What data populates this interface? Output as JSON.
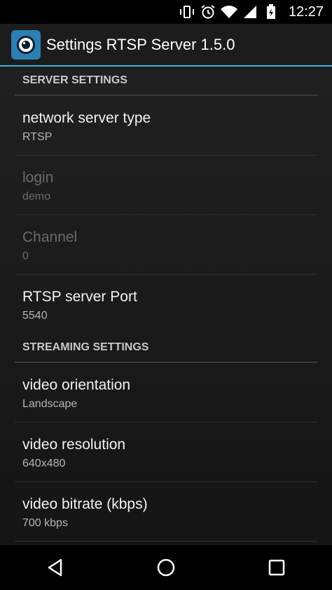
{
  "statusbar": {
    "time": "12:27",
    "icons": [
      "vibrate-icon",
      "alarm-icon",
      "wifi-icon",
      "signal-icon",
      "battery-icon"
    ]
  },
  "actionbar": {
    "title": "Settings RTSP Server 1.5.0",
    "accent_color": "#33b5e5",
    "app_icon_color": "#2d7fb3"
  },
  "sections": {
    "server": {
      "header": "SERVER SETTINGS",
      "prefs": [
        {
          "title": "network server type",
          "summary": "RTSP",
          "enabled": true
        },
        {
          "title": "login",
          "summary": "demo",
          "enabled": false
        },
        {
          "title": "Channel",
          "summary": "0",
          "enabled": false
        },
        {
          "title": "RTSP server Port",
          "summary": "5540",
          "enabled": true
        }
      ]
    },
    "streaming": {
      "header": "STREAMING SETTINGS",
      "prefs": [
        {
          "title": "video orientation",
          "summary": "Landscape",
          "enabled": true
        },
        {
          "title": "video resolution",
          "summary": "640x480",
          "enabled": true
        },
        {
          "title": "video bitrate (kbps)",
          "summary": "700 kbps",
          "enabled": true
        }
      ]
    }
  },
  "navbar": {
    "buttons": [
      "back-icon",
      "home-icon",
      "recents-icon"
    ]
  }
}
